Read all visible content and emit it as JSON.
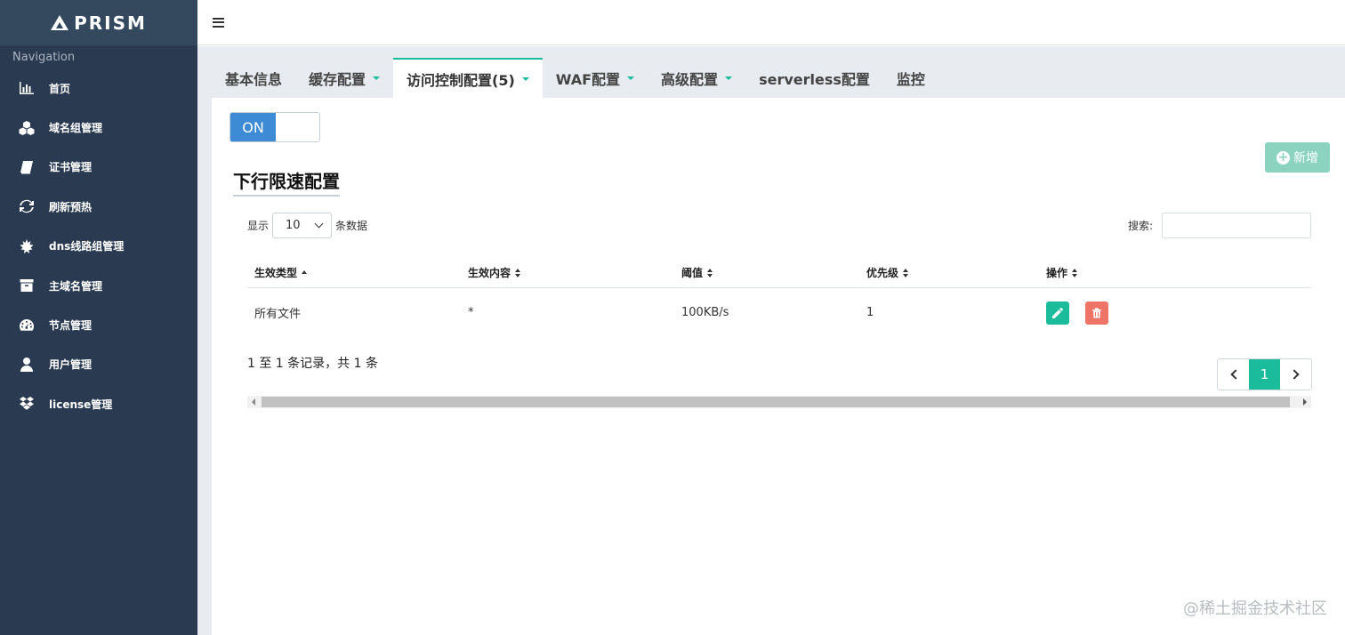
{
  "app": {
    "brand": "PRISM"
  },
  "sidebar": {
    "nav_title": "Navigation",
    "items": [
      {
        "label": "首页",
        "icon": "bar-chart-icon"
      },
      {
        "label": "域名组管理",
        "icon": "cubes-icon"
      },
      {
        "label": "证书管理",
        "icon": "book-icon"
      },
      {
        "label": "刷新预热",
        "icon": "refresh-icon"
      },
      {
        "label": "dns线路组管理",
        "icon": "leaf-icon"
      },
      {
        "label": "主域名管理",
        "icon": "archive-icon"
      },
      {
        "label": "节点管理",
        "icon": "dashboard-icon"
      },
      {
        "label": "用户管理",
        "icon": "user-icon"
      },
      {
        "label": "license管理",
        "icon": "dropbox-icon"
      }
    ]
  },
  "tabs": [
    {
      "label": "基本信息",
      "dropdown": false,
      "active": false
    },
    {
      "label": "缓存配置",
      "dropdown": true,
      "active": false
    },
    {
      "label": "访问控制配置(5)",
      "dropdown": true,
      "active": true
    },
    {
      "label": "WAF配置",
      "dropdown": true,
      "active": false
    },
    {
      "label": "高级配置",
      "dropdown": true,
      "active": false
    },
    {
      "label": "serverless配置",
      "dropdown": false,
      "active": false
    },
    {
      "label": "监控",
      "dropdown": false,
      "active": false
    }
  ],
  "toggle": {
    "label": "ON"
  },
  "add_button": {
    "label": "新增"
  },
  "section": {
    "title": "下行限速配置"
  },
  "length": {
    "prefix": "显示",
    "value": "10",
    "suffix": "条数据"
  },
  "search": {
    "label": "搜索:",
    "value": ""
  },
  "table": {
    "columns": [
      "生效类型",
      "生效内容",
      "阈值",
      "优先级",
      "操作"
    ],
    "rows": [
      {
        "type": "所有文件",
        "content": "*",
        "threshold": "100KB/s",
        "priority": "1"
      }
    ]
  },
  "info": {
    "text": "1 至 1 条记录，共 1 条"
  },
  "pagination": {
    "current": "1"
  },
  "watermark": {
    "text": "@稀土掘金技术社区"
  },
  "colors": {
    "accent": "#1abc9c",
    "sidebar": "#2a3b51",
    "toggle_on": "#3d8bd4",
    "delete": "#ee7468"
  }
}
